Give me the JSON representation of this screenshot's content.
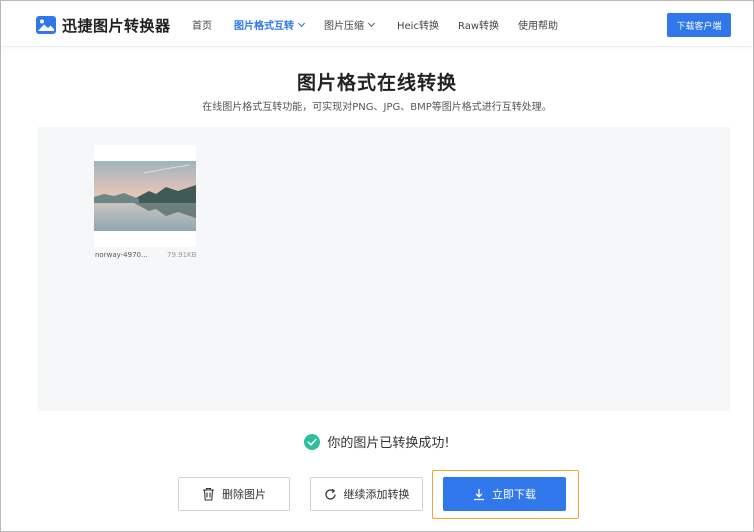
{
  "header": {
    "logo_text": "迅捷图片转换器",
    "nav": [
      {
        "label": "首页",
        "active": false,
        "has_dropdown": false
      },
      {
        "label": "图片格式互转",
        "active": true,
        "has_dropdown": true
      },
      {
        "label": "图片压缩",
        "active": false,
        "has_dropdown": true
      },
      {
        "label": "Heic转换",
        "active": false,
        "has_dropdown": false
      },
      {
        "label": "Raw转换",
        "active": false,
        "has_dropdown": false
      },
      {
        "label": "使用帮助",
        "active": false,
        "has_dropdown": false
      }
    ],
    "download_client_label": "下载客户端"
  },
  "main": {
    "title": "图片格式在线转换",
    "subtitle": "在线图片格式互转功能，可实现对PNG、JPG、BMP等图片格式进行互转处理。"
  },
  "files": [
    {
      "name": "norway-4970...",
      "size": "79.91KB"
    }
  ],
  "status": {
    "icon": "check-circle-icon",
    "text": "你的图片已转换成功!"
  },
  "actions": {
    "delete_label": "删除图片",
    "continue_label": "继续添加转换",
    "download_label": "立即下载"
  },
  "colors": {
    "primary": "#2f77ea",
    "success": "#2bbf9b",
    "highlight": "#f2a33a"
  }
}
